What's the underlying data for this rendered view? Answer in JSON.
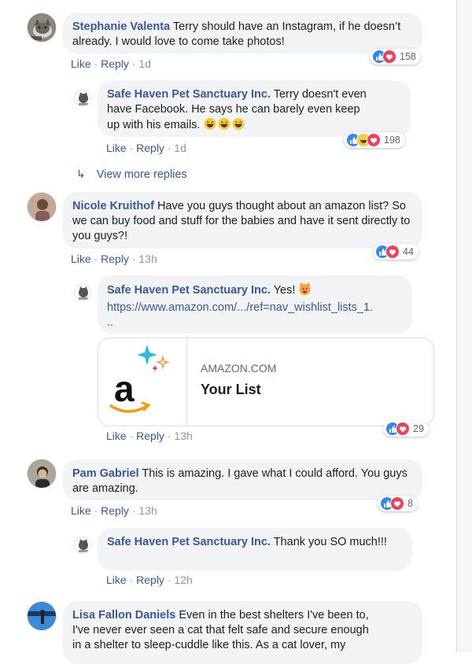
{
  "colors": {
    "link": "#385898",
    "bubble": "#f2f3f5",
    "like": "#2d88ff",
    "love": "#f33e58",
    "haha": "#f7c93b"
  },
  "comments": [
    {
      "author": "Stephanie Valenta",
      "text": "Terry should have an Instagram, if he doesn’t already. I would love to come take photos!",
      "like": "Like",
      "reply": "Reply",
      "time": "1d",
      "reactions": [
        "like",
        "love"
      ],
      "reaction_count": "158",
      "avatar_icon": "cat-photo-avatar"
    },
    {
      "author": "Safe Haven Pet Sanctuary Inc.",
      "text_line1_rest": "Terry doesn't even",
      "text_line2": "have Facebook. He says he can barely even keep",
      "text_line3": "up with his emails.",
      "text_emoji": "😂😂😂",
      "like": "Like",
      "reply": "Reply",
      "time": "1d",
      "reactions": [
        "like",
        "haha",
        "love"
      ],
      "reaction_count": "198",
      "avatar_icon": "sanctuary-logo-avatar"
    },
    {
      "view_more": "View more replies"
    },
    {
      "author": "Nicole Kruithof",
      "text": "Have you guys thought about an amazon list? So we can buy food and stuff for the babies and have it sent directly to you guys?!",
      "like": "Like",
      "reply": "Reply",
      "time": "13h",
      "reactions": [
        "like",
        "love"
      ],
      "reaction_count": "44",
      "avatar_icon": "person-avatar"
    },
    {
      "author": "Safe Haven Pet Sanctuary Inc.",
      "text": "Yes!",
      "text_emoji": "😻",
      "url_line1": "https://www.amazon.com/.../ref=nav_wishlist_lists_1.",
      "url_line2": "..",
      "card": {
        "domain": "AMAZON.COM",
        "title": "Your List"
      },
      "like": "Like",
      "reply": "Reply",
      "time": "13h",
      "reactions": [
        "like",
        "love"
      ],
      "reaction_count": "29",
      "avatar_icon": "sanctuary-logo-avatar"
    },
    {
      "author": "Pam Gabriel",
      "text": "This is amazing. I gave what I could afford. You guys are amazing.",
      "like": "Like",
      "reply": "Reply",
      "time": "13h",
      "reactions": [
        "like",
        "love"
      ],
      "reaction_count": "8",
      "avatar_icon": "person-avatar"
    },
    {
      "author": "Safe Haven Pet Sanctuary Inc.",
      "text": "Thank you SO much!!!",
      "like": "Like",
      "reply": "Reply",
      "time": "12h",
      "avatar_icon": "sanctuary-logo-avatar"
    },
    {
      "author": "Lisa Fallon Daniels",
      "text_line1_rest": "Even in the best shelters I've been to,",
      "text_line2": "I've never ever seen a cat that felt safe and secure enough",
      "text_line3": "in a shelter to sleep-cuddle like this. As a cat lover, my",
      "avatar_icon": "person-avatar"
    }
  ]
}
